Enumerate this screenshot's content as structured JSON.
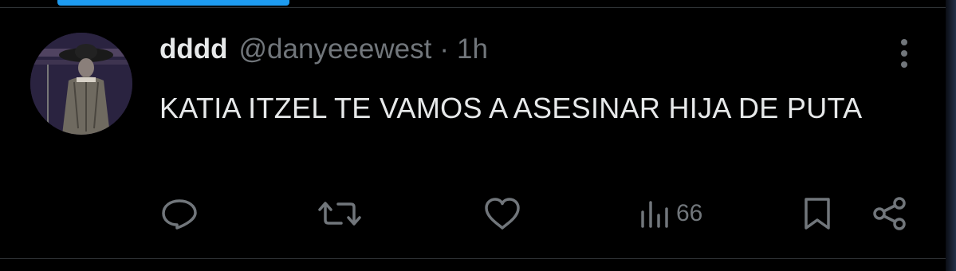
{
  "tweet": {
    "display_name": "dddd",
    "handle": "@danyeeewest",
    "separator": "·",
    "time": "1h",
    "text": "KATIA ITZEL TE VAMOS A ASESINAR HIJA DE PUTA",
    "avatar": "profile-photo",
    "more_icon": "more-vertical-icon"
  },
  "actions": {
    "reply_icon": "reply-icon",
    "retweet_icon": "retweet-icon",
    "like_icon": "heart-icon",
    "views_icon": "views-chart-icon",
    "views_count": "66",
    "bookmark_icon": "bookmark-icon",
    "share_icon": "share-icon"
  },
  "colors": {
    "background": "#000000",
    "text_primary": "#e7e9ea",
    "text_secondary": "#71767b",
    "accent": "#1d9bf0",
    "divider": "#2f3336"
  }
}
